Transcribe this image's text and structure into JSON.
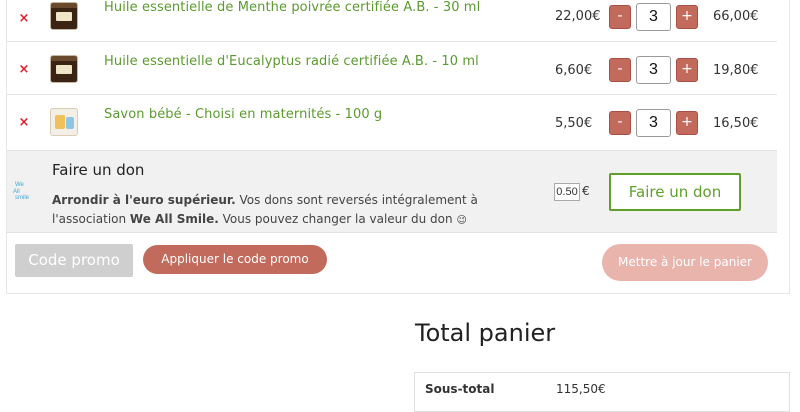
{
  "cart": {
    "items": [
      {
        "name": "Huile essentielle de Menthe poivrée certifiée A.B. - 30 ml",
        "price": "22,00€",
        "qty": "3",
        "subtotal": "66,00€",
        "remove_icon": "×",
        "thumb": "bottle"
      },
      {
        "name": "Huile essentielle d'Eucalyptus radié certifiée A.B. - 10 ml",
        "price": "6,60€",
        "qty": "3",
        "subtotal": "19,80€",
        "remove_icon": "×",
        "thumb": "bottle"
      },
      {
        "name": "Savon bébé - Choisi en maternités - 100 g",
        "price": "5,50€",
        "qty": "3",
        "subtotal": "16,50€",
        "remove_icon": "×",
        "thumb": "soap"
      }
    ],
    "minus_label": "-",
    "plus_label": "+"
  },
  "donation": {
    "title": "Faire un don",
    "text_bold_1": "Arrondir à l'euro supérieur.",
    "text_1": " Vos dons sont reversés intégralement à l'association ",
    "text_bold_2": "We All Smile.",
    "text_2": " Vous pouvez changer la valeur du don ",
    "emoji": "😉",
    "amount": "0.50",
    "currency": "€",
    "button": "Faire un don",
    "logo_text": "We All Smile"
  },
  "coupon": {
    "placeholder": "Code promo",
    "apply_label": "Appliquer le code promo"
  },
  "update_label": "Mettre à jour le panier",
  "totals": {
    "title": "Total panier",
    "subtotal_label": "Sous-total",
    "subtotal_value": "115,50€"
  },
  "colors": {
    "accent_red": "#c26a5c",
    "accent_green": "#5fa02a",
    "remove_red": "#d9232d"
  }
}
